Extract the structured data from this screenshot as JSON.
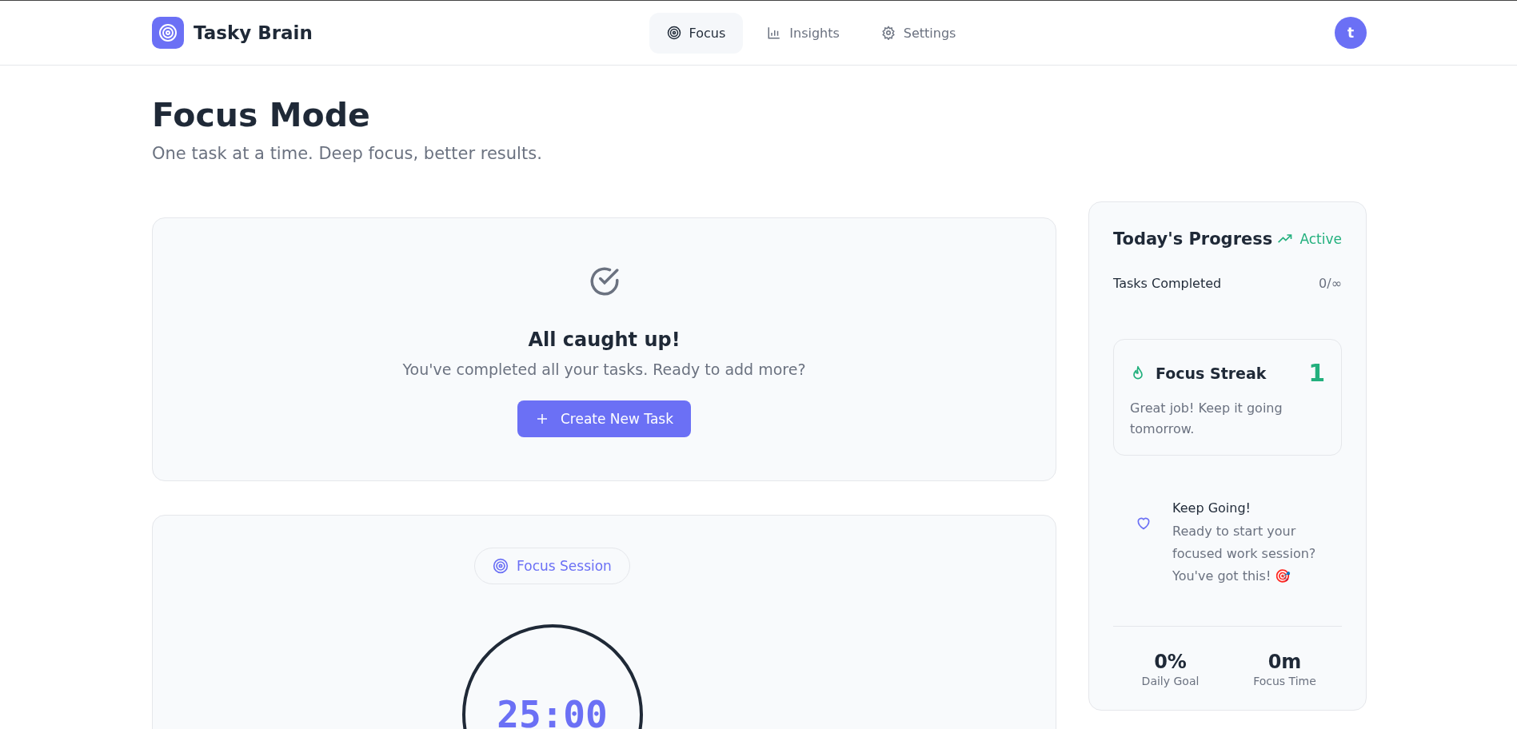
{
  "app": {
    "name": "Tasky Brain",
    "avatar_initial": "t"
  },
  "nav": [
    {
      "label": "Focus",
      "kind": "target",
      "selected": true
    },
    {
      "label": "Insights",
      "kind": "chart",
      "selected": false
    },
    {
      "label": "Settings",
      "kind": "gear",
      "selected": false
    }
  ],
  "page": {
    "title": "Focus Mode",
    "subtitle": "One task at a time. Deep focus, better results."
  },
  "empty_state": {
    "title": "All caught up!",
    "message": "You've completed all your tasks. Ready to add more?",
    "button": "Create New Task"
  },
  "session": {
    "badge": "Focus Session",
    "timer": "25:00"
  },
  "progress": {
    "title": "Today's Progress",
    "status": "Active",
    "tasks_label": "Tasks Completed",
    "tasks_value": "0/∞",
    "streak": {
      "title": "Focus Streak",
      "count": "1",
      "message": "Great job! Keep it going tomorrow."
    },
    "motivation": {
      "title": "Keep Going!",
      "message": "Ready to start your focused work session? You've got this! 🎯"
    },
    "stats": [
      {
        "value": "0%",
        "label": "Daily Goal"
      },
      {
        "value": "0m",
        "label": "Focus Time"
      }
    ]
  }
}
